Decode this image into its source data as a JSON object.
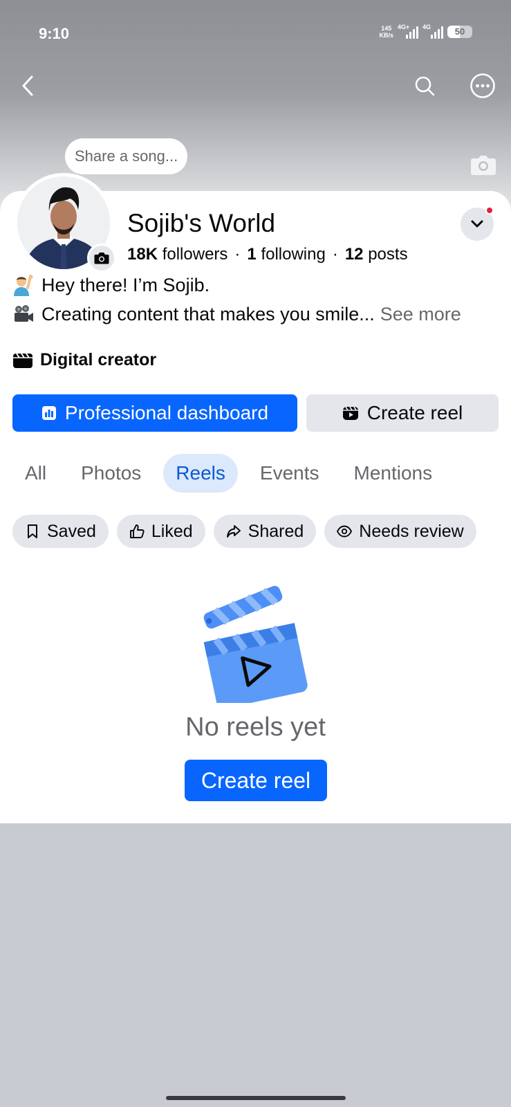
{
  "status_bar": {
    "time": "9:10",
    "net_speed_value": "145",
    "net_speed_unit": "KB/s",
    "sim1_label": "4G+",
    "sim2_label": "4G",
    "battery": "50",
    "battery_level": 0.5
  },
  "nav": {
    "back_icon": "chevron-left-icon",
    "search_icon": "search-icon",
    "more_icon": "more-horizontal-icon"
  },
  "song_prompt": "Share a song...",
  "profile": {
    "name": "Sojib's World",
    "followers_count": "18K",
    "followers_label": "followers",
    "following_count": "1",
    "following_label": "following",
    "posts_count": "12",
    "posts_label": "posts",
    "separator": "·"
  },
  "bio": {
    "line1": "Hey there! I’m Sojib.",
    "line2": "Creating content that makes you smile...",
    "see_more": "See more",
    "line1_emoji": "man-raising-hand-emoji",
    "line2_emoji": "movie-camera-emoji"
  },
  "category": "Digital creator",
  "actions": {
    "dashboard_label": "Professional dashboard",
    "create_reel_label": "Create reel"
  },
  "tabs": [
    {
      "label": "All",
      "active": false
    },
    {
      "label": "Photos",
      "active": false
    },
    {
      "label": "Reels",
      "active": true
    },
    {
      "label": "Events",
      "active": false
    },
    {
      "label": "Mentions",
      "active": false
    }
  ],
  "filters": [
    {
      "label": "Saved",
      "icon": "bookmark-icon"
    },
    {
      "label": "Liked",
      "icon": "thumbs-up-icon"
    },
    {
      "label": "Shared",
      "icon": "share-arrow-icon"
    },
    {
      "label": "Needs review",
      "icon": "eye-icon"
    }
  ],
  "empty_state": {
    "illustration": "clapperboard-play-icon",
    "title": "No reels yet",
    "cta": "Create reel"
  },
  "colors": {
    "primary": "#0866ff",
    "active_tab_bg": "#dce8fb",
    "active_tab_text": "#0a5ad4",
    "notification": "#e41e3f"
  }
}
